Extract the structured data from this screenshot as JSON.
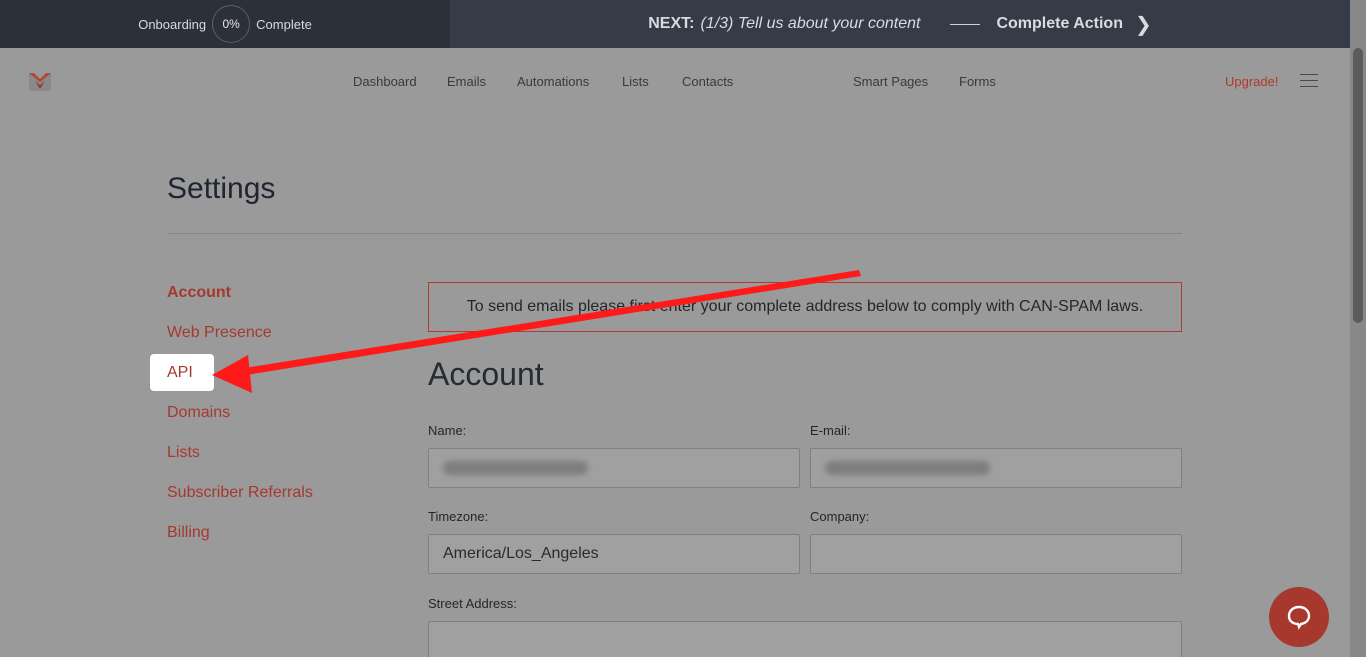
{
  "onboarding": {
    "label": "Onboarding",
    "percent": "0%",
    "complete": "Complete",
    "next_label": "NEXT:",
    "next_task": "(1/3) Tell us about your content",
    "action": "Complete Action"
  },
  "nav": {
    "items": [
      "Dashboard",
      "Emails",
      "Automations",
      "Lists",
      "Contacts",
      "Smart Pages",
      "Forms"
    ],
    "upgrade": "Upgrade!"
  },
  "settings": {
    "title": "Settings",
    "sidebar": [
      "Account",
      "Web Presence",
      "API",
      "Domains",
      "Lists",
      "Subscriber Referrals",
      "Billing"
    ]
  },
  "notice": "To send emails please first enter your complete address below to comply with CAN-SPAM laws.",
  "account": {
    "title": "Account",
    "name_label": "Name:",
    "email_label": "E-mail:",
    "timezone_label": "Timezone:",
    "timezone_value": "America/Los_Angeles",
    "company_label": "Company:",
    "street_label": "Street Address:"
  },
  "colors": {
    "accent": "#b03a2e",
    "highlight_text": "#e6584b",
    "annotation_arrow": "#ff0000"
  }
}
